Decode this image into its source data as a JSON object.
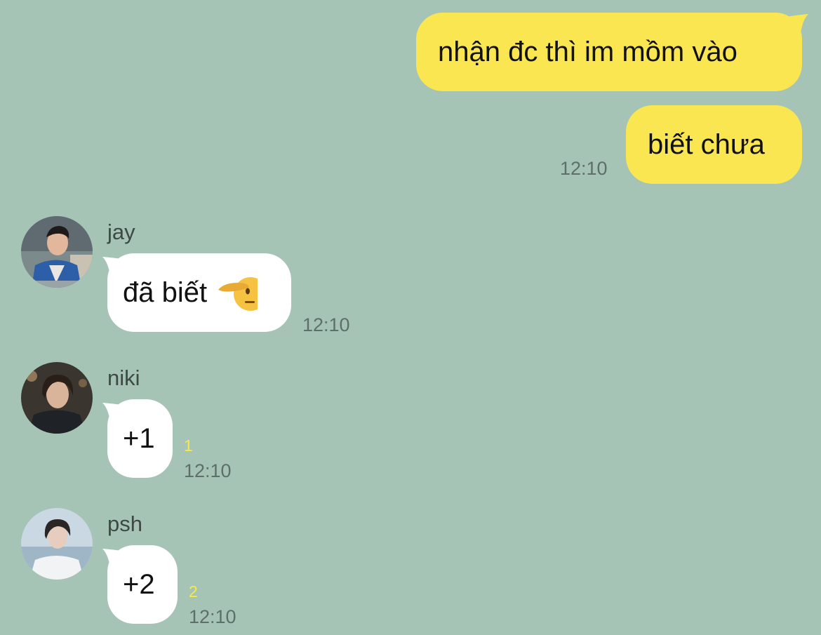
{
  "colors": {
    "background": "#a6c4b6",
    "outgoing_bubble": "#fae650",
    "incoming_bubble": "#ffffff",
    "time_text": "#5d6f68",
    "unread_count": "#f4ea4c"
  },
  "messages": {
    "outgoing": [
      {
        "text": "nhận đc thì im mồm vào"
      },
      {
        "text": "biết chưa",
        "time": "12:10"
      }
    ],
    "incoming": [
      {
        "sender": "jay",
        "text": "đã biết",
        "emoji": "saluting-face-icon",
        "time": "12:10"
      },
      {
        "sender": "niki",
        "text": "+1",
        "unread": "1",
        "time": "12:10"
      },
      {
        "sender": "psh",
        "text": "+2",
        "unread": "2",
        "time": "12:10"
      }
    ]
  }
}
